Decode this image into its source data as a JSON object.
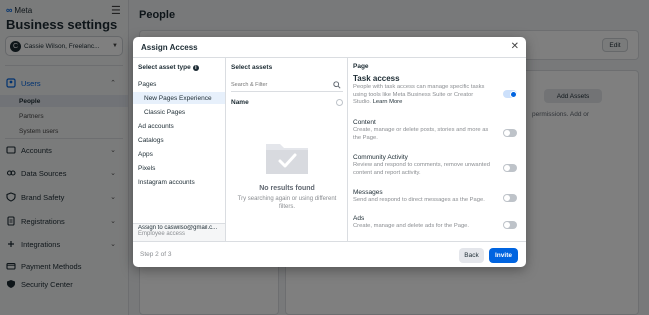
{
  "app": {
    "logo_text": "Meta",
    "title": "Business settings",
    "account_initial": "C",
    "account_name": "Cassie Wilson, Freelanc...",
    "page_heading": "People"
  },
  "sidebar": {
    "groups": [
      {
        "label": "Users",
        "icon": "users-icon",
        "expanded": true
      },
      {
        "label": "Accounts",
        "icon": "accounts-icon"
      },
      {
        "label": "Data Sources",
        "icon": "data-sources-icon"
      },
      {
        "label": "Brand Safety",
        "icon": "brand-safety-icon"
      },
      {
        "label": "Registrations",
        "icon": "registrations-icon"
      },
      {
        "label": "Integrations",
        "icon": "integrations-icon"
      },
      {
        "label": "Payment Methods",
        "icon": "payment-icon"
      },
      {
        "label": "Security Center",
        "icon": "security-icon"
      }
    ],
    "users_sub": [
      "People",
      "Partners",
      "System users"
    ]
  },
  "background": {
    "edit_label": "Edit",
    "add_assets_label": "Add Assets",
    "permissions_snippet": "permissions. Add or"
  },
  "modal": {
    "title": "Assign Access",
    "left_header": "Select asset type",
    "asset_types": [
      "Pages",
      "New Pages Experience",
      "Classic Pages",
      "Ad accounts",
      "Catalogs",
      "Apps",
      "Pixels",
      "Instagram accounts"
    ],
    "assign_to": "Assign to caswilso@gmail.c...",
    "assign_role": "Employee access",
    "mid_header": "Select assets",
    "search_placeholder": "Search & Filter",
    "name_header": "Name",
    "no_results": "No results found",
    "no_results_sub": "Try searching again or using different filters.",
    "right_header": "Page",
    "task_access_title": "Task access",
    "task_access_desc": "People with task access can manage specific tasks using tools like Meta Business Suite or Creator Studio.",
    "learn_more": "Learn More",
    "permissions": [
      {
        "title": "Content",
        "desc": "Create, manage or delete posts, stories and more as the Page."
      },
      {
        "title": "Community Activity",
        "desc": "Review and respond to comments, remove unwanted content and report activity."
      },
      {
        "title": "Messages",
        "desc": "Send and respond to direct messages as the Page."
      },
      {
        "title": "Ads",
        "desc": "Create, manage and delete ads for the Page."
      }
    ],
    "step_text": "Step 2 of 3",
    "back_label": "Back",
    "invite_label": "Invite"
  },
  "colors": {
    "accent": "#0064e0",
    "overlay": "rgba(0,0,0,0.5)"
  }
}
